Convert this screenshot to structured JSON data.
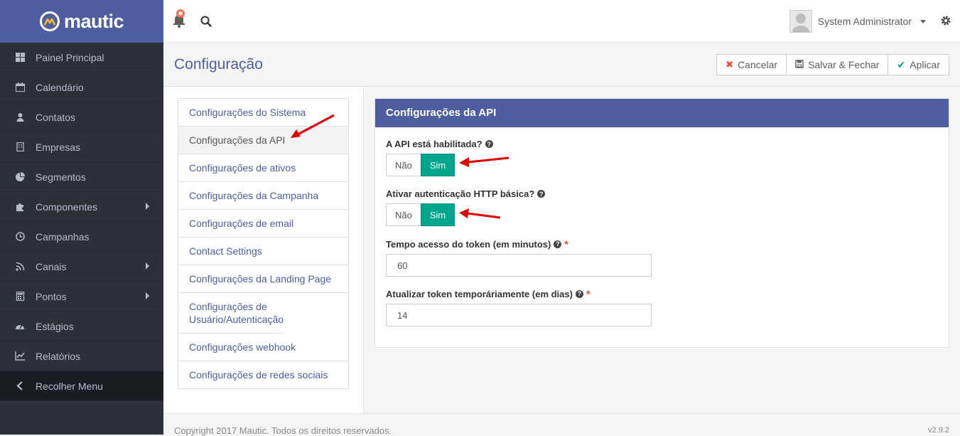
{
  "brand": {
    "name": "mautic"
  },
  "sidebar": {
    "items": [
      {
        "label": "Painel Principal",
        "icon": "dashboard-icon",
        "submenu": false
      },
      {
        "label": "Calendário",
        "icon": "calendar-icon",
        "submenu": false
      },
      {
        "label": "Contatos",
        "icon": "user-icon",
        "submenu": false
      },
      {
        "label": "Empresas",
        "icon": "building-icon",
        "submenu": false
      },
      {
        "label": "Segmentos",
        "icon": "pie-chart-icon",
        "submenu": false
      },
      {
        "label": "Componentes",
        "icon": "puzzle-icon",
        "submenu": true
      },
      {
        "label": "Campanhas",
        "icon": "clock-icon",
        "submenu": false
      },
      {
        "label": "Canais",
        "icon": "rss-icon",
        "submenu": true
      },
      {
        "label": "Pontos",
        "icon": "calculator-icon",
        "submenu": true
      },
      {
        "label": "Estágios",
        "icon": "tachometer-icon",
        "submenu": false
      },
      {
        "label": "Relatórios",
        "icon": "line-chart-icon",
        "submenu": false
      }
    ],
    "collapse_label": "Recolher Menu"
  },
  "topbar": {
    "user_name": "System Administrator"
  },
  "header": {
    "title": "Configuração",
    "buttons": {
      "cancel": "Cancelar",
      "save_close": "Salvar & Fechar",
      "apply": "Aplicar"
    }
  },
  "config_menu": [
    "Configurações do Sistema",
    "Configurações da API",
    "Configurações de ativos",
    "Configurações da Campanha",
    "Configurações de email",
    "Contact Settings",
    "Configurações da Landing Page",
    "Configurações de Usuário/Autenticação",
    "Configurações webhook",
    "Configurações de redes sociais"
  ],
  "config_menu_active_index": 1,
  "panel": {
    "title": "Configurações da API",
    "api_enabled": {
      "label": "A API está habilitada?",
      "no": "Não",
      "yes": "Sim",
      "selected": "Sim"
    },
    "basic_auth": {
      "label": "Ativar autenticação HTTP básica?",
      "no": "Não",
      "yes": "Sim",
      "selected": "Sim"
    },
    "token_lifetime": {
      "label": "Tempo acesso do token (em minutos)",
      "value": "60",
      "required": "*"
    },
    "refresh_token": {
      "label": "Atualizar token temporáriamente (em dias)",
      "value": "14",
      "required": "*"
    }
  },
  "footer": {
    "copyright": "Copyright 2017 Mautic. Todos os direitos reservados.",
    "version": "v2.9.2"
  },
  "colors": {
    "brand": "#4e5e9e",
    "sidebar": "#2c3039",
    "success": "#00a68c",
    "annotation_arrow": "#e00000"
  }
}
